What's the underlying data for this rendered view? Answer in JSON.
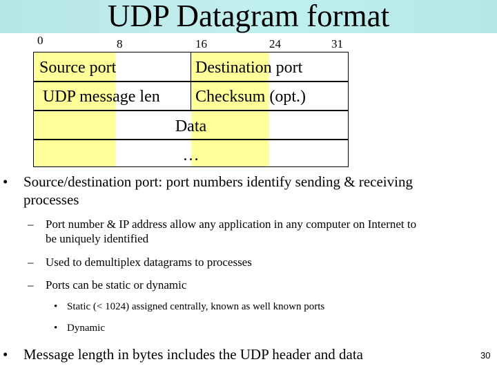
{
  "slide": {
    "title": "UDP Datagram format",
    "page_number": "30",
    "colors": {
      "banner": "#bdebeb",
      "highlight": "#ffff99",
      "text": "#000000"
    }
  },
  "diagram": {
    "bit_markers": [
      "0",
      "8",
      "16",
      "24",
      "31"
    ],
    "rows": [
      {
        "cells": [
          "Source port",
          "Destination port"
        ]
      },
      {
        "cells": [
          "UDP message len",
          "Checksum (opt.)"
        ]
      },
      {
        "cells": [
          "Data"
        ]
      },
      {
        "cells": [
          "…"
        ]
      }
    ]
  },
  "bullets": [
    {
      "level": 1,
      "marker": "•",
      "lines": [
        "Source/destination port: port numbers identify sending & receiving",
        "processes"
      ]
    },
    {
      "level": 2,
      "marker": "–",
      "lines": [
        "Port number & IP address allow any application in any computer on Internet to",
        "be uniquely identified"
      ]
    },
    {
      "level": 2,
      "marker": "–",
      "lines": [
        "Used to demultiplex datagrams to processes"
      ]
    },
    {
      "level": 2,
      "marker": "–",
      "lines": [
        "Ports can be static or dynamic"
      ]
    },
    {
      "level": 3,
      "marker": "•",
      "lines": [
        "Static (< 1024) assigned centrally, known as well known ports"
      ]
    },
    {
      "level": 3,
      "marker": "•",
      "lines": [
        "Dynamic"
      ]
    },
    {
      "level": 1,
      "marker": "•",
      "lines": [
        "Message length in bytes includes the UDP header and data"
      ]
    }
  ]
}
